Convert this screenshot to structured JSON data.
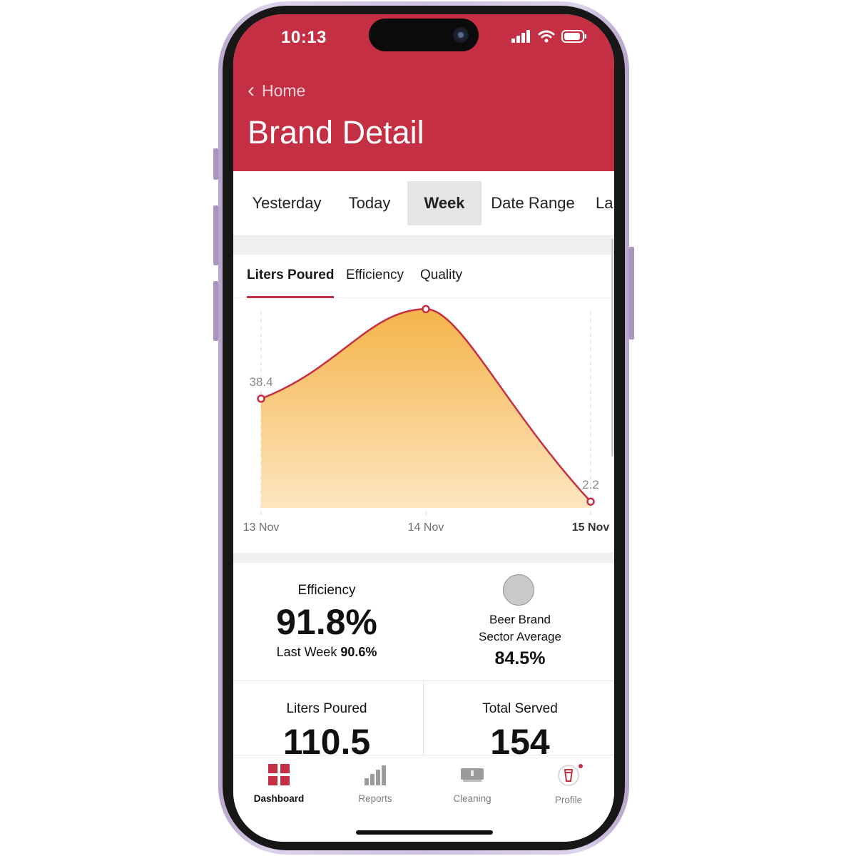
{
  "status_bar": {
    "time": "10:13",
    "icons": [
      "cellular-signal-icon",
      "wifi-icon",
      "battery-icon"
    ]
  },
  "header": {
    "back_label": "Home",
    "back_icon": "chevron-left-icon",
    "title": "Brand Detail"
  },
  "period_tabs": [
    {
      "label": "Yesterday",
      "active": false
    },
    {
      "label": "Today",
      "active": false
    },
    {
      "label": "Week",
      "active": true
    },
    {
      "label": "Date Range",
      "active": false
    },
    {
      "label": "La",
      "active": false
    }
  ],
  "metric_tabs": [
    {
      "label": "Liters Poured",
      "active": true
    },
    {
      "label": "Efficiency",
      "active": false
    },
    {
      "label": "Quality",
      "active": false
    }
  ],
  "chart_data": {
    "type": "area",
    "categories": [
      "13 Nov",
      "14 Nov",
      "15 Nov"
    ],
    "values": [
      38.4,
      69.9,
      2.2
    ],
    "value_labels": [
      "38.4",
      "69.9",
      "2.2"
    ],
    "highlight_category": "15 Nov",
    "ylim": [
      0,
      80
    ],
    "grid": "vertical dashed",
    "colors": {
      "line": "#c52f43",
      "fill_top": "#f4b349",
      "fill_bottom": "#fde6c0"
    }
  },
  "efficiency": {
    "label": "Efficiency",
    "value": "91.8%",
    "last_week_label": "Last Week",
    "last_week_value": "90.6%"
  },
  "sector": {
    "line1": "Beer Brand",
    "line2": "Sector Average",
    "value": "84.5%"
  },
  "liters": {
    "label": "Liters Poured",
    "value": "110.5"
  },
  "served": {
    "label": "Total Served",
    "value": "154"
  },
  "bottom_nav": [
    {
      "label": "Dashboard",
      "icon": "dashboard-grid-icon",
      "active": true
    },
    {
      "label": "Reports",
      "icon": "bar-chart-icon",
      "active": false
    },
    {
      "label": "Cleaning",
      "icon": "cleaning-icon",
      "active": false
    },
    {
      "label": "Profile",
      "icon": "profile-glass-icon",
      "active": false,
      "notification_dot": true
    }
  ],
  "colors": {
    "brand": "#c52f43",
    "active_tab_bg": "#e5e5e5"
  }
}
